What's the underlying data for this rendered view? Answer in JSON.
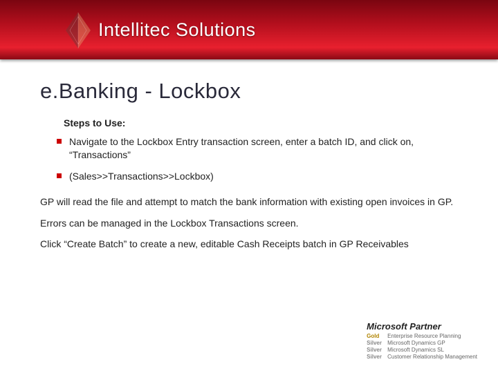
{
  "header": {
    "brand": "Intellitec Solutions"
  },
  "title": "e.Banking - Lockbox",
  "subtitle": "Steps to Use:",
  "bullets": [
    "Navigate to the Lockbox Entry transaction screen, enter a batch ID, and click on, “Transactions”",
    "(Sales>>Transactions>>Lockbox)"
  ],
  "paragraphs": [
    "GP will read the file and attempt to match the bank information with existing open invoices in GP.",
    "Errors can be managed in the Lockbox Transactions screen.",
    "Click “Create Batch” to create a new, editable Cash Receipts batch in GP Receivables"
  ],
  "footer": {
    "partner": "Microsoft Partner",
    "lines": [
      {
        "tier": "Gold",
        "capability": "Enterprise Resource Planning"
      },
      {
        "tier": "Silver",
        "capability": "Microsoft Dynamics GP"
      },
      {
        "tier": "Silver",
        "capability": "Microsoft Dynamics SL"
      },
      {
        "tier": "Silver",
        "capability": "Customer Relationship Management"
      }
    ]
  }
}
